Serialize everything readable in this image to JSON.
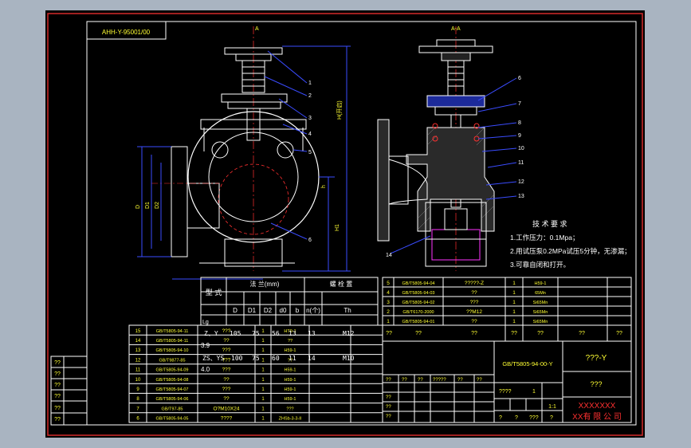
{
  "colors": {
    "workspace": "#a9b4c1",
    "sheet": "#000000",
    "frame_red": "#d22a2a",
    "line_white": "#ffffff",
    "line_blue": "#3a4cff",
    "line_magenta": "#ff33ff",
    "line_red": "#ff3030",
    "text_yellow": "#ffff33",
    "text_white": "#ffffff",
    "accent_cyan": "#33ffff"
  },
  "title_code": "AHH-Y-95001/00",
  "section_label_top": "A-A",
  "section_marker_top": "A",
  "dim_labels": {
    "height_right": "H(开启)",
    "height_body": "H1",
    "width_offset": "h",
    "d_left": "D",
    "d_mid": "D1",
    "d_in": "D2",
    "dn": "dN"
  },
  "callouts_left": [
    "1",
    "2",
    "3",
    "4",
    "5",
    "6"
  ],
  "callouts_right": [
    "6",
    "7",
    "8",
    "9",
    "10",
    "11",
    "12",
    "13",
    "14"
  ],
  "tech_req": {
    "title": "技 术 要 求",
    "items": [
      "1.工作压力：0.1Mpa；",
      "2.用试压泵0.2MPa试压5分钟，无渗漏；",
      "3.可靠自闭和打开。"
    ]
  },
  "spec_table": {
    "header": [
      "型 式",
      "法 兰(mm)",
      "螺 栓 置"
    ],
    "subheader": [
      "D",
      "D1",
      "D2",
      "d0",
      "b",
      "n(个)",
      "Th"
    ],
    "leftcol": [
      "Z、Y",
      "ZS、YS"
    ],
    "rows": [
      [
        "105",
        "75",
        "56",
        "13",
        "13",
        "",
        "M12"
      ],
      [
        "100",
        "75",
        "60",
        "11",
        "14",
        "",
        "M10"
      ]
    ],
    "side_labels": [
      "Lg",
      "3.9",
      "4.0"
    ]
  },
  "bom_left": {
    "rows": [
      [
        "15",
        "GB/T5805-94-11",
        "???",
        "1",
        "HT9-1",
        ""
      ],
      [
        "14",
        "GB/T5805-94-11",
        "??",
        "1",
        "??",
        ""
      ],
      [
        "13",
        "GB/T5805-94-10",
        "???",
        "1",
        "H59-1",
        ""
      ],
      [
        "12",
        "GB/T9877-85",
        "???",
        "1",
        "??",
        ""
      ],
      [
        "11",
        "GB/T5805-94-09",
        "???",
        "1",
        "H59-1",
        ""
      ],
      [
        "10",
        "GB/T5805-94-08",
        "??",
        "1",
        "H59-1",
        ""
      ],
      [
        "9",
        "GB/T5805-94-07",
        "???",
        "1",
        "H59-1",
        ""
      ],
      [
        "8",
        "GB/T5805-94-06",
        "??",
        "1",
        "H59-1",
        ""
      ],
      [
        "7",
        "GB/T97-85",
        "O?M10X24",
        "1",
        "???",
        ""
      ],
      [
        "6",
        "GB/T5805-94-05",
        "????",
        "1",
        "ZHSb-3-3-II",
        ""
      ]
    ]
  },
  "bom_right": {
    "rows": [
      [
        "5",
        "GB/T5805-94-04",
        "?????-Z",
        "1",
        "H59-1"
      ],
      [
        "4",
        "GB/T5805-94-03",
        "??",
        "1",
        "65Mn"
      ],
      [
        "3",
        "GB/T5805-94-02",
        "???",
        "1",
        "Si65Mn"
      ],
      [
        "2",
        "GB/T6170-2000",
        "??M12",
        "1",
        "Si65Mn"
      ],
      [
        "1",
        "GB/T5805-94-01",
        "??",
        "1",
        "Si65Mn"
      ]
    ],
    "header": [
      "??",
      "??",
      "??",
      "??",
      "??",
      "??",
      "??"
    ]
  },
  "title_block": {
    "drawing_no": "GB/T5805-94-00-Y",
    "product": "???-Y",
    "material": "???",
    "scale": "1:1",
    "sheet": "1",
    "company_line1": "XXXXXXX",
    "company_line2": "XX有 限 公 司",
    "misc_marks": [
      "??",
      "??",
      "??",
      "?????",
      "??",
      "??"
    ],
    "row_marks": [
      "????",
      "??",
      "??",
      "??"
    ],
    "bottom_marks": [
      "?",
      "?",
      "???",
      "?"
    ]
  },
  "left_strip": [
    "??",
    "??",
    "??",
    "??",
    "??",
    "??"
  ]
}
